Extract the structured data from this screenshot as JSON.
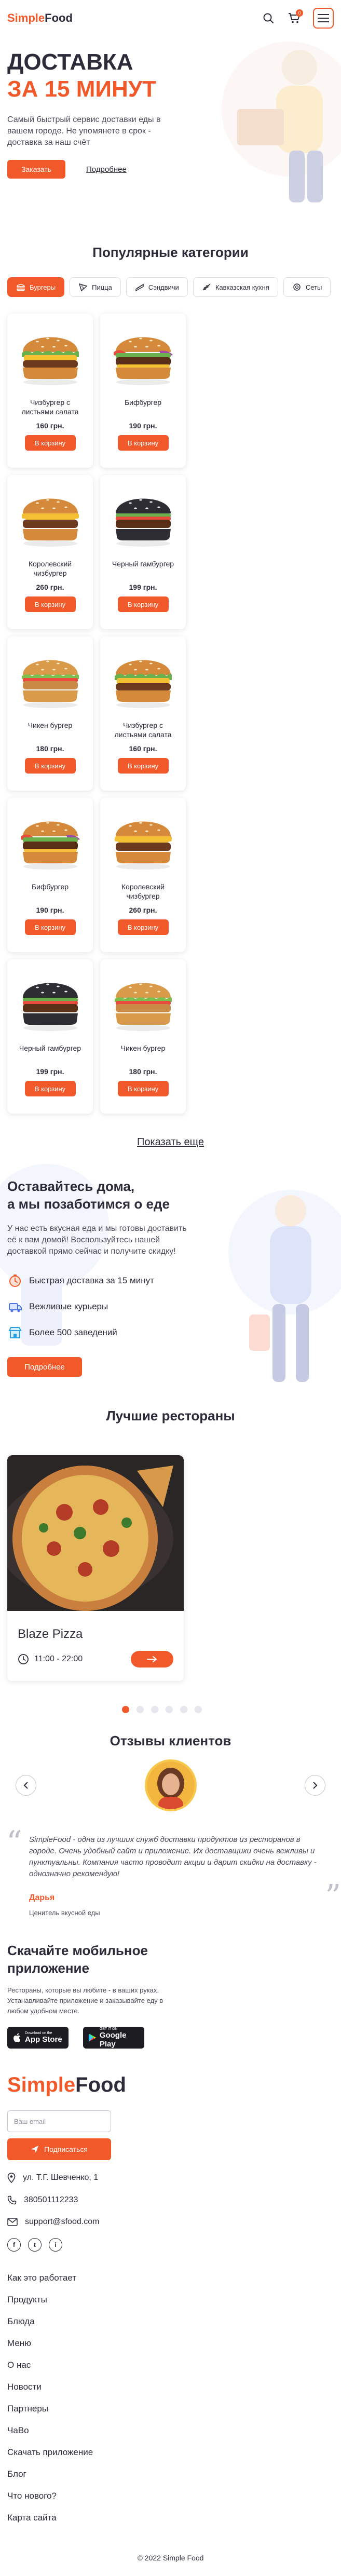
{
  "header": {
    "logo_a": "Simple",
    "logo_b": "Food",
    "cart_count": "0"
  },
  "hero": {
    "title_line1": "ДОСТАВКА",
    "title_line2": "ЗА 15 МИНУТ",
    "text": "Самый быстрый сервис доставки еды в вашем городе. Не упомянете в срок - доставка за наш счёт",
    "order_label": "Заказать",
    "more_label": "Подробнее"
  },
  "categories": {
    "title": "Популярные категории",
    "items": [
      {
        "label": "Бургеры",
        "icon": "burger-icon"
      },
      {
        "label": "Пицца",
        "icon": "pizza-icon"
      },
      {
        "label": "Сэндвичи",
        "icon": "sandwich-icon"
      },
      {
        "label": "Кавказская кухня",
        "icon": "kebab-icon"
      },
      {
        "label": "Сеты",
        "icon": "set-icon"
      }
    ]
  },
  "products": {
    "cart_label": "В корзину",
    "items": [
      {
        "name": "Чизбургер с листьями салата",
        "price": "160 грн.",
        "kind": "lettuce"
      },
      {
        "name": "Бифбургер",
        "price": "190 грн.",
        "kind": "beef"
      },
      {
        "name": "Королевский чизбургер",
        "price": "260 грн.",
        "kind": "royal"
      },
      {
        "name": "Черный гамбургер",
        "price": "199 грн.",
        "kind": "black"
      },
      {
        "name": "Чикен бургер",
        "price": "180 грн.",
        "kind": "chicken"
      },
      {
        "name": "Чизбургер с листьями салата",
        "price": "160 грн.",
        "kind": "lettuce"
      },
      {
        "name": "Бифбургер",
        "price": "190 грн.",
        "kind": "beef"
      },
      {
        "name": "Королевский чизбургер",
        "price": "260 грн.",
        "kind": "royal"
      },
      {
        "name": "Черный гамбургер",
        "price": "199 грн.",
        "kind": "black"
      },
      {
        "name": "Чикен бургер",
        "price": "180 грн.",
        "kind": "chicken"
      }
    ],
    "show_more": "Показать еще"
  },
  "stay_home": {
    "title_line1": "Оставайтесь дома,",
    "title_line2": "а мы позаботимся о еде",
    "text": "У нас есть вкусная еда и мы готовы доставить её к вам домой! Воспользуйтесь нашей доставкой прямо сейчас и получите скидку!",
    "features": [
      {
        "label": "Быстрая доставка за 15 минут",
        "icon": "timer-icon"
      },
      {
        "label": "Вежливые курьеры",
        "icon": "courier-icon"
      },
      {
        "label": "Более 500 заведений",
        "icon": "store-icon"
      }
    ],
    "cta": "Подробнее"
  },
  "restaurants": {
    "title": "Лучшие рестораны",
    "name": "Blaze Pizza",
    "hours": "11:00 - 22:00",
    "dots": 6,
    "active_dot": 0
  },
  "reviews": {
    "title": "Отзывы клиентов",
    "text": "SimpleFood - одна из лучших служб доставки продуктов из ресторанов в городе. Очень удобный сайт и приложение. Их доставщики очень вежливы и пунктуальны. Компания часто проводит акции и дарит скидки на доставку - однозначно рекомендую!",
    "author": "Дарья",
    "role": "Ценитель вкусной еды"
  },
  "app": {
    "title_line1": "Скачайте мобильное",
    "title_line2": "приложение",
    "text": "Рестораны, которые вы любите - в ваших руках. Устанавливайте приложение и заказывайте еду в любом удобном месте.",
    "appstore_small": "Download on the",
    "appstore_big": "App Store",
    "gplay_small": "GET IT ON",
    "gplay_big": "Google Play"
  },
  "footer": {
    "logo_a": "Simple",
    "logo_b": "Food",
    "email_placeholder": "Ваш email",
    "subscribe": "Подписаться",
    "address": "ул. Т.Г. Шевченко, 1",
    "phone": "380501112233",
    "email": "support@sfood.com",
    "socials": [
      "f",
      "t",
      "i"
    ],
    "nav": [
      "Как это работает",
      "Продукты",
      "Блюда",
      "Меню",
      "О нас",
      "Новости",
      "Партнеры",
      "ЧаВо",
      "Скачать приложение",
      "Блог",
      "Что нового?",
      "Карта сайта"
    ],
    "copyright": "© 2022 Simple Food"
  },
  "colors": {
    "accent": "#f2592a",
    "text": "#2b2b3a"
  }
}
